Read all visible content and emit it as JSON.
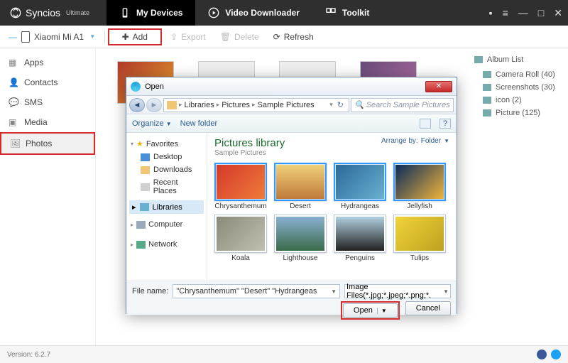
{
  "app": {
    "name": "Syncios",
    "edition": "Ultimate"
  },
  "topTabs": [
    {
      "label": "My Devices"
    },
    {
      "label": "Video Downloader"
    },
    {
      "label": "Toolkit"
    }
  ],
  "device": {
    "name": "Xiaomi Mi A1"
  },
  "actions": {
    "add": "Add",
    "export": "Export",
    "delete": "Delete",
    "refresh": "Refresh"
  },
  "sidebar": [
    {
      "label": "Apps"
    },
    {
      "label": "Contacts"
    },
    {
      "label": "SMS"
    },
    {
      "label": "Media"
    },
    {
      "label": "Photos"
    }
  ],
  "albumList": {
    "title": "Album List",
    "items": [
      {
        "label": "Camera Roll (40)"
      },
      {
        "label": "Screenshots (30)"
      },
      {
        "label": "icon (2)"
      },
      {
        "label": "Picture (125)"
      }
    ]
  },
  "dialog": {
    "title": "Open",
    "breadcrumb": {
      "root": "Libraries",
      "a": "Pictures",
      "b": "Sample Pictures"
    },
    "searchPlaceholder": "Search Sample Pictures",
    "organize": "Organize",
    "newFolder": "New folder",
    "nav": {
      "favorites": "Favorites",
      "desktop": "Desktop",
      "downloads": "Downloads",
      "recent": "Recent Places",
      "libraries": "Libraries",
      "computer": "Computer",
      "network": "Network"
    },
    "library": {
      "title": "Pictures library",
      "subtitle": "Sample Pictures"
    },
    "arrange": {
      "label": "Arrange by:",
      "value": "Folder"
    },
    "pictures": [
      {
        "name": "Chrysanthemum",
        "sel": true,
        "bg": "linear-gradient(135deg,#d43a2a,#f07a3a)"
      },
      {
        "name": "Desert",
        "sel": true,
        "bg": "linear-gradient(180deg,#f0d07a,#c07a3a)"
      },
      {
        "name": "Hydrangeas",
        "sel": true,
        "bg": "linear-gradient(135deg,#2a6a9a,#6ab0d0)"
      },
      {
        "name": "Jellyfish",
        "sel": true,
        "bg": "linear-gradient(135deg,#0a2a5a,#f0b43a)"
      },
      {
        "name": "Koala",
        "sel": false,
        "bg": "linear-gradient(135deg,#8a8a7a,#c0c0b0)"
      },
      {
        "name": "Lighthouse",
        "sel": false,
        "bg": "linear-gradient(180deg,#8ab0d0,#3a6a4a)"
      },
      {
        "name": "Penguins",
        "sel": false,
        "bg": "linear-gradient(180deg,#b0d0e0,#202020)"
      },
      {
        "name": "Tulips",
        "sel": false,
        "bg": "linear-gradient(135deg,#f0d43a,#c0a020)"
      }
    ],
    "fileNameLabel": "File name:",
    "fileNameValue": "\"Chrysanthemum\" \"Desert\" \"Hydrangeas",
    "fileTypeValue": "Image Files(*.jpg;*.jpeg;*.png;*.",
    "open": "Open",
    "cancel": "Cancel"
  },
  "footer": {
    "version": "Version: 6.2.7"
  }
}
